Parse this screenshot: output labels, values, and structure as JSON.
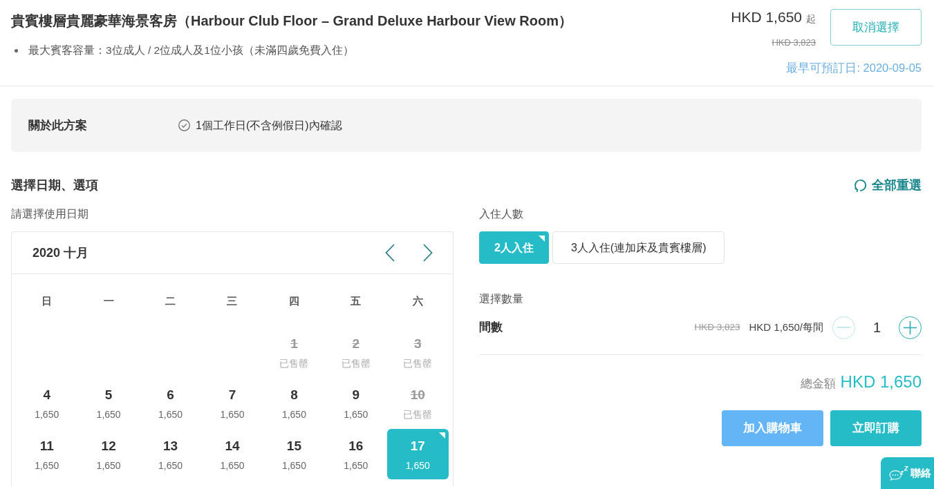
{
  "header": {
    "title": "貴賓樓層貴麗豪華海景客房（Harbour Club Floor – Grand Deluxe Harbour View Room）",
    "features": [
      "最大賓客容量：3位成人 / 2位成人及1位小孩（未滿四歲免費入住）"
    ],
    "price": "HKD 1,650",
    "price_suffix": "起",
    "original_price": "HKD 3,823",
    "cancel_button": "取消選擇",
    "earliest_date": "最早可預訂日: 2020-09-05"
  },
  "about": {
    "label": "關於此方案",
    "items": [
      "1個工作日(不含例假日)內確認"
    ]
  },
  "selection": {
    "heading": "選擇日期、選項",
    "reset": "全部重選"
  },
  "calendar": {
    "prompt": "請選擇使用日期",
    "month": "2020 十月",
    "weekdays": [
      "日",
      "一",
      "二",
      "三",
      "四",
      "五",
      "六"
    ],
    "weeks": [
      [
        {
          "kind": "blank"
        },
        {
          "kind": "blank"
        },
        {
          "kind": "blank"
        },
        {
          "kind": "blank"
        },
        {
          "kind": "sold_out",
          "day": "1",
          "note": "已售罄",
          "selected": false
        },
        {
          "kind": "sold_out",
          "day": "2",
          "note": "已售罄",
          "selected": false
        },
        {
          "kind": "sold_out",
          "day": "3",
          "note": "已售罄",
          "selected": false
        }
      ],
      [
        {
          "kind": "available",
          "day": "4",
          "price": "1,650",
          "selected": false
        },
        {
          "kind": "available",
          "day": "5",
          "price": "1,650",
          "selected": false
        },
        {
          "kind": "available",
          "day": "6",
          "price": "1,650",
          "selected": false
        },
        {
          "kind": "available",
          "day": "7",
          "price": "1,650",
          "selected": false
        },
        {
          "kind": "available",
          "day": "8",
          "price": "1,650",
          "selected": false
        },
        {
          "kind": "available",
          "day": "9",
          "price": "1,650",
          "selected": false
        },
        {
          "kind": "sold_out",
          "day": "10",
          "note": "已售罄",
          "selected": false
        }
      ],
      [
        {
          "kind": "available",
          "day": "11",
          "price": "1,650",
          "selected": false
        },
        {
          "kind": "available",
          "day": "12",
          "price": "1,650",
          "selected": false
        },
        {
          "kind": "available",
          "day": "13",
          "price": "1,650",
          "selected": false
        },
        {
          "kind": "available",
          "day": "14",
          "price": "1,650",
          "selected": false
        },
        {
          "kind": "available",
          "day": "15",
          "price": "1,650",
          "selected": false
        },
        {
          "kind": "available",
          "day": "16",
          "price": "1,650",
          "selected": false
        },
        {
          "kind": "available",
          "day": "17",
          "price": "1,650",
          "selected": true
        }
      ]
    ]
  },
  "occupancy": {
    "label": "入住人數",
    "options": [
      {
        "label": "2人入住",
        "selected": true
      },
      {
        "label": "3人入住(連加床及貴賓樓層)",
        "selected": false
      }
    ]
  },
  "quantity": {
    "heading": "選擇數量",
    "label": "間數",
    "original_price": "HKD 3,823",
    "price": "HKD 1,650/每間",
    "value": "1",
    "decrease_disabled": true,
    "increase_disabled": false
  },
  "total": {
    "label": "總金額",
    "amount": "HKD 1,650"
  },
  "actions": [
    {
      "kind": "cart",
      "label": "加入購物車"
    },
    {
      "kind": "buy",
      "label": "立即訂購"
    }
  ],
  "chat": {
    "label": "聯絡"
  }
}
